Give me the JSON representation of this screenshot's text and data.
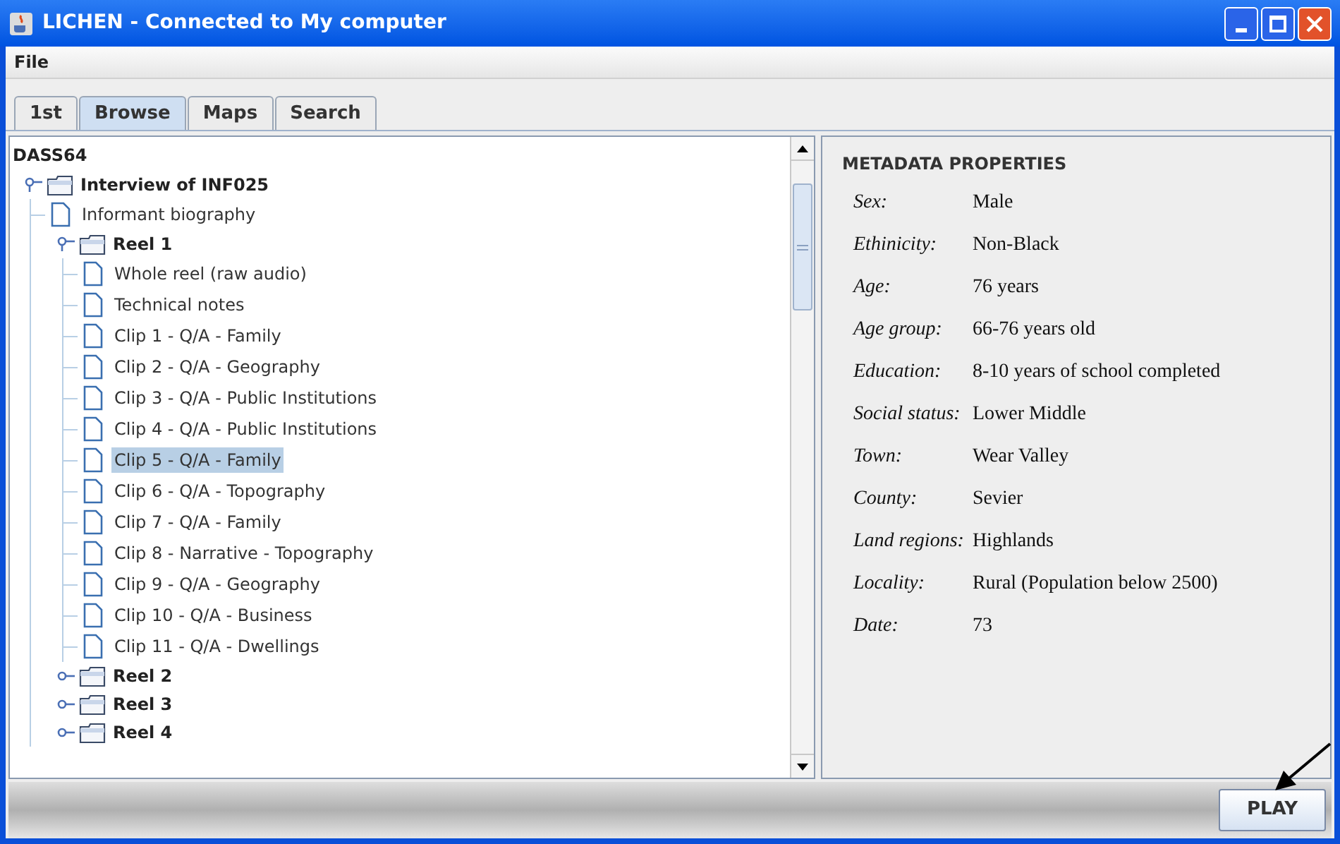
{
  "window": {
    "title": "LICHEN - Connected to My computer"
  },
  "menu": [
    "File"
  ],
  "tabs": [
    {
      "label": "1st",
      "selected": false
    },
    {
      "label": "Browse",
      "selected": true
    },
    {
      "label": "Maps",
      "selected": false
    },
    {
      "label": "Search",
      "selected": false
    }
  ],
  "tree": {
    "root": "DASS64",
    "children": [
      {
        "kind": "folder",
        "label": "Interview of INF025",
        "expanded": true,
        "children": [
          {
            "kind": "file",
            "label": "Informant biography",
            "selected": false
          },
          {
            "kind": "folder",
            "label": "Reel 1",
            "expanded": true,
            "children": [
              {
                "kind": "file",
                "label": "Whole reel (raw audio)",
                "selected": false
              },
              {
                "kind": "file",
                "label": "Technical notes",
                "selected": false
              },
              {
                "kind": "file",
                "label": "Clip 1 - Q/A - Family",
                "selected": false
              },
              {
                "kind": "file",
                "label": "Clip 2 - Q/A - Geography",
                "selected": false
              },
              {
                "kind": "file",
                "label": "Clip 3 - Q/A - Public Institutions",
                "selected": false
              },
              {
                "kind": "file",
                "label": "Clip 4 - Q/A - Public Institutions",
                "selected": false
              },
              {
                "kind": "file",
                "label": "Clip 5 - Q/A - Family",
                "selected": true
              },
              {
                "kind": "file",
                "label": "Clip 6 - Q/A - Topography",
                "selected": false
              },
              {
                "kind": "file",
                "label": "Clip 7 - Q/A - Family",
                "selected": false
              },
              {
                "kind": "file",
                "label": "Clip 8 - Narrative - Topography",
                "selected": false
              },
              {
                "kind": "file",
                "label": "Clip 9 - Q/A - Geography",
                "selected": false
              },
              {
                "kind": "file",
                "label": "Clip 10 - Q/A - Business",
                "selected": false
              },
              {
                "kind": "file",
                "label": "Clip 11 - Q/A - Dwellings",
                "selected": false
              }
            ]
          },
          {
            "kind": "folder",
            "label": "Reel 2",
            "expanded": false
          },
          {
            "kind": "folder",
            "label": "Reel 3",
            "expanded": false
          },
          {
            "kind": "folder",
            "label": "Reel 4",
            "expanded": false
          }
        ]
      }
    ]
  },
  "metadata": {
    "title": "METADATA PROPERTIES",
    "properties": [
      {
        "key": "Sex:",
        "value": "Male"
      },
      {
        "key": "Ethinicity:",
        "value": "Non-Black"
      },
      {
        "key": "Age:",
        "value": "76 years"
      },
      {
        "key": "Age group:",
        "value": "66-76 years old"
      },
      {
        "key": "Education:",
        "value": "8-10 years of school completed"
      },
      {
        "key": "Social status:",
        "value": "Lower Middle"
      },
      {
        "key": "Town:",
        "value": "Wear Valley"
      },
      {
        "key": "County:",
        "value": "Sevier"
      },
      {
        "key": "Land regions:",
        "value": "Highlands"
      },
      {
        "key": "Locality:",
        "value": "Rural (Population below 2500)"
      },
      {
        "key": "Date:",
        "value": "73"
      }
    ]
  },
  "play_button": "PLAY"
}
